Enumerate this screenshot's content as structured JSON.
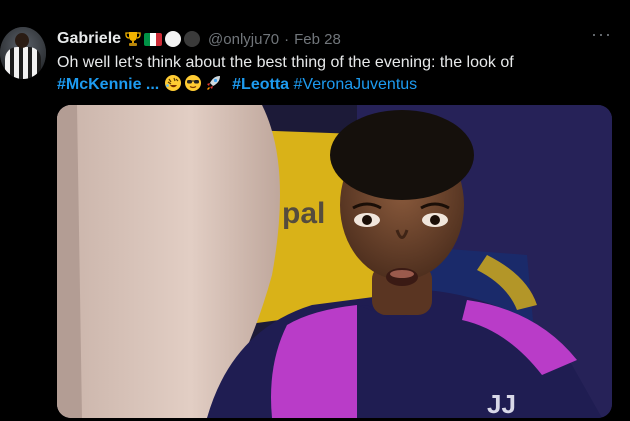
{
  "tweet": {
    "display_name": "Gabriele",
    "badges": [
      "trophy-emoji",
      "italy-flag-emoji",
      "white-circle-emoji",
      "black-circle-emoji"
    ],
    "handle": "@onlyju70",
    "separator": "·",
    "date": "Feb 28",
    "more_label": "···",
    "text_line1": "Oh well let's think about the best thing of the evening: the look of",
    "hashtag_mckennie": "#McKennie",
    "ellipsis": " ...",
    "emojis": [
      "rolling-on-floor-laughing-emoji",
      "smiling-face-with-sunglasses-emoji",
      "rocket-emoji"
    ],
    "hashtag_leotta": "#Leotta",
    "hashtag_verona": "#VeronaJuventus"
  },
  "media": {
    "background_sign_text": "pal",
    "shirt_logo_text": "JJ"
  },
  "colors": {
    "background": "#000000",
    "text": "#e7e9ea",
    "muted": "#71767b",
    "link": "#1d9bf0"
  }
}
